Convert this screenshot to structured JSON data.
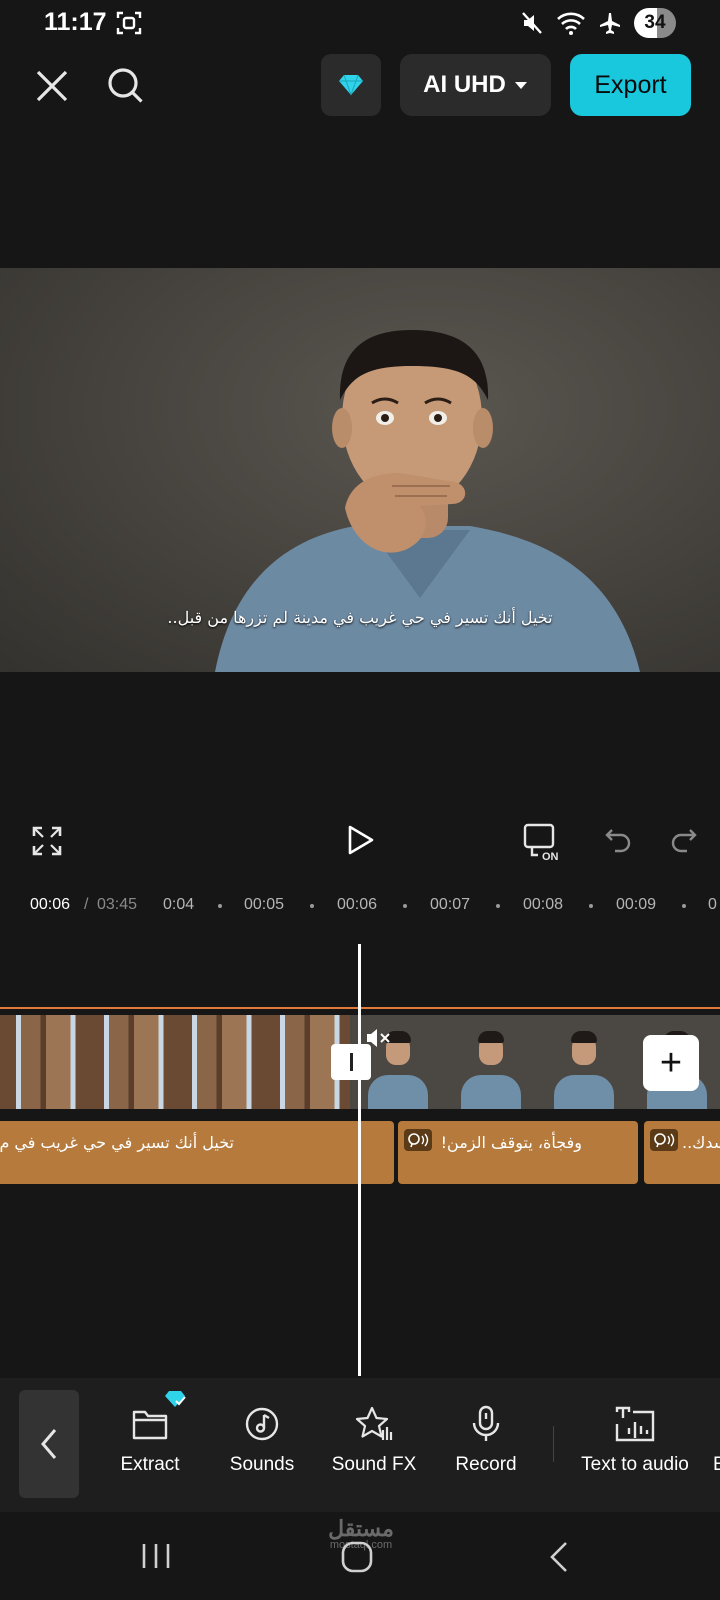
{
  "status_bar": {
    "time": "11:17",
    "battery": "34"
  },
  "top_bar": {
    "quality_label": "AI UHD",
    "export_label": "Export"
  },
  "preview": {
    "subtitle": "تخيل أنك تسير في حي غريب في مدينة لم تزرها من قبل.."
  },
  "timeline": {
    "current_time": "00:06",
    "separator": "/",
    "total_time": "03:45",
    "ticks": [
      "0:04",
      "00:05",
      "00:06",
      "00:07",
      "00:08",
      "00:09",
      "0"
    ],
    "text_clips": [
      {
        "text": "تخيل أنك تسير في حي غريب في م"
      },
      {
        "text": "وفجأة، يتوقف الزمن!"
      },
      {
        "text": "سدك.."
      }
    ]
  },
  "toolbar": {
    "items": [
      {
        "label": "Extract",
        "icon": "folder-icon"
      },
      {
        "label": "Sounds",
        "icon": "music-note-icon"
      },
      {
        "label": "Sound FX",
        "icon": "star-sound-icon"
      },
      {
        "label": "Record",
        "icon": "microphone-icon"
      },
      {
        "label": "Text to audio",
        "icon": "text-to-audio-icon"
      }
    ],
    "partial_label": "E"
  },
  "watermark": {
    "arabic": "مستقل",
    "latin": "mostaql.com"
  },
  "colors": {
    "accent": "#19c8dd",
    "text_clip": "#b57a3c",
    "timeline_line": "#e07a3a"
  }
}
